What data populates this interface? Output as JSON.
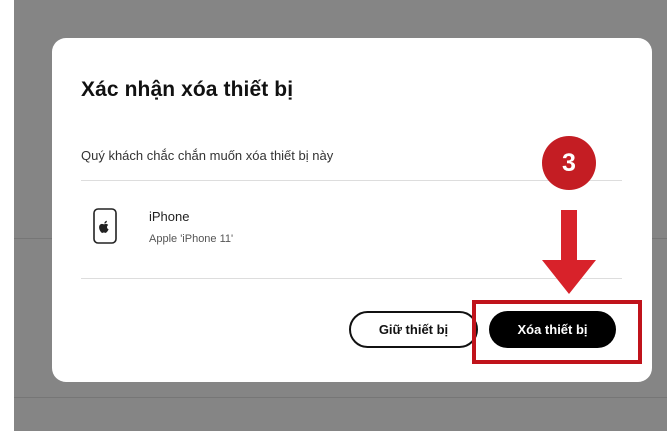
{
  "dialog": {
    "title": "Xác nhận xóa thiết bị",
    "question": "Quý khách chắc chắn muốn xóa thiết bị này",
    "device": {
      "name": "iPhone",
      "model": "Apple 'iPhone 11'",
      "icon": "phone-apple-icon"
    },
    "buttons": {
      "keep_label": "Giữ thiết bị",
      "delete_label": "Xóa thiết bị"
    }
  },
  "annotation": {
    "step_number": "3",
    "arrow_icon": "arrow-down-icon",
    "accent_color": "#c41d23"
  },
  "colors": {
    "backdrop": "#858585",
    "modal": "#ffffff",
    "primary_button": "#000000"
  }
}
